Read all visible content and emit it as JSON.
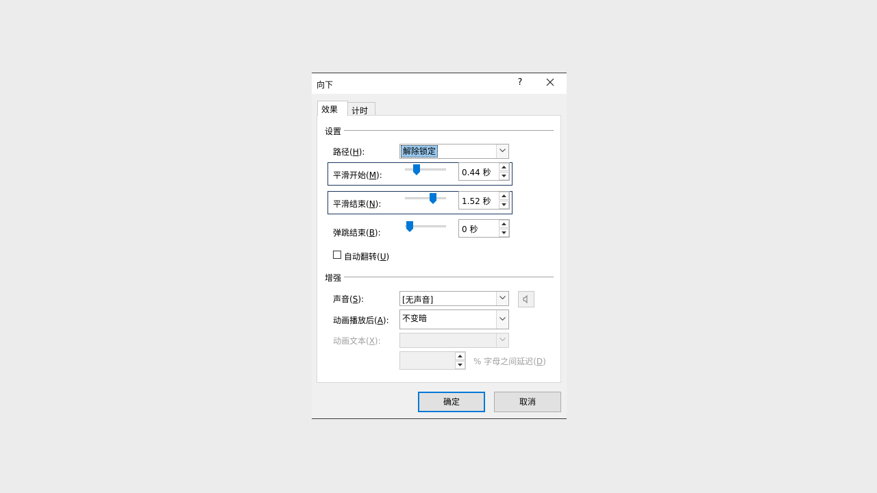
{
  "dialog": {
    "title": "向下",
    "help": "?",
    "tabs": [
      {
        "label": "效果",
        "active": true
      },
      {
        "label": "计时",
        "active": false
      }
    ],
    "settings": {
      "group_title": "设置",
      "path": {
        "label_prefix": "路径(",
        "key": "H",
        "label_suffix": "):",
        "value": "解除锁定"
      },
      "smooth_start": {
        "label_prefix": "平滑开始(",
        "key": "M",
        "label_suffix": "):",
        "value": "0.44 秒"
      },
      "smooth_end": {
        "label_prefix": "平滑结束(",
        "key": "N",
        "label_suffix": "):",
        "value": "1.52 秒"
      },
      "bounce_end": {
        "label_prefix": "弹跳结束(",
        "key": "B",
        "label_suffix": "):",
        "value": "0 秒"
      },
      "auto_reverse": {
        "label_prefix": "自动翻转(",
        "key": "U",
        "label_suffix": ")",
        "checked": false
      }
    },
    "enhance": {
      "group_title": "增强",
      "sound": {
        "label_prefix": "声音(",
        "key": "S",
        "label_suffix": "):",
        "value": "[无声音]"
      },
      "after_animation": {
        "label_prefix": "动画播放后(",
        "key": "A",
        "label_suffix": "):",
        "value": "不变暗"
      },
      "animate_text": {
        "label_prefix": "动画文本(",
        "key": "X",
        "label_suffix": "):",
        "value": ""
      },
      "delay": {
        "value": "",
        "label_prefix": "% 字母之间延迟(",
        "key": "D",
        "label_suffix": ")"
      }
    },
    "ok_label": "确定",
    "cancel_label": "取消"
  }
}
